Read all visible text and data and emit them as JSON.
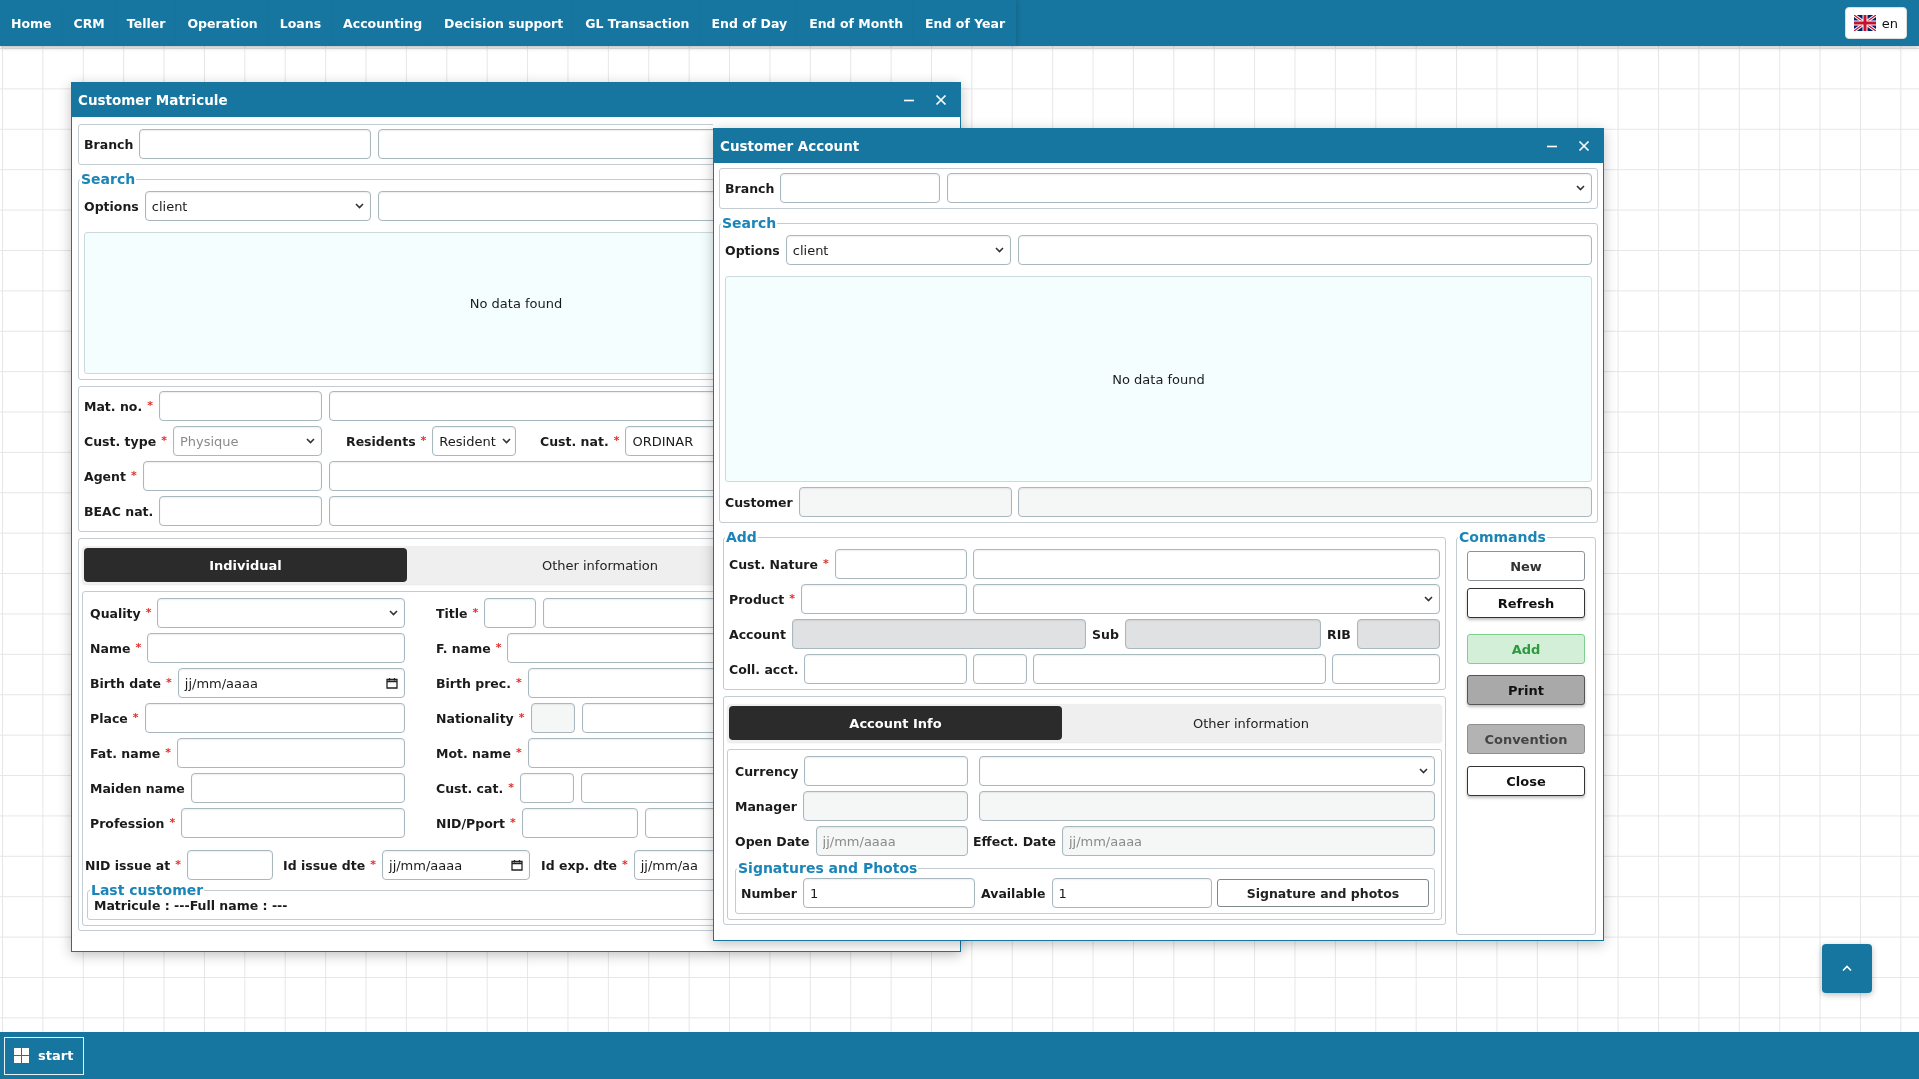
{
  "navbar": {
    "items": [
      {
        "label": "Home"
      },
      {
        "label": "CRM"
      },
      {
        "label": "Teller"
      },
      {
        "label": "Operation"
      },
      {
        "label": "Loans"
      },
      {
        "label": "Accounting"
      },
      {
        "label": "Decision support"
      },
      {
        "label": "GL Transaction"
      },
      {
        "label": "End of Day"
      },
      {
        "label": "End of Month"
      },
      {
        "label": "End of Year"
      }
    ],
    "language": "en"
  },
  "matricule_window": {
    "title": "Customer Matricule",
    "branch_row": [
      {
        "label": "Branch",
        "fields": [
          {
            "kind": "text"
          }
        ]
      },
      {
        "fields": [
          {
            "kind": "text"
          }
        ]
      }
    ],
    "search": {
      "legend": "Search",
      "options_row": [
        {
          "label": "Options",
          "fields": [
            {
              "kind": "select",
              "value": "client"
            }
          ]
        },
        {
          "fields": [
            {
              "kind": "text"
            }
          ]
        }
      ],
      "results": "No data found"
    },
    "identity_rows": [
      [
        {
          "label": "Mat. no.",
          "mark": "*",
          "fields": [
            {
              "kind": "text"
            }
          ]
        },
        {
          "fields": [
            {
              "kind": "text"
            }
          ]
        }
      ],
      [
        {
          "label": "Cust. type",
          "mark": "*",
          "fields": [
            {
              "kind": "select",
              "placeholder": "Physique"
            }
          ]
        },
        {
          "label": "Residents",
          "mark": "*",
          "fields": [
            {
              "kind": "select",
              "value": "Resident"
            }
          ]
        },
        {
          "label": "Cust. nat.",
          "mark": "*",
          "fields": [
            {
              "kind": "text",
              "value": "ORDINAR"
            }
          ]
        }
      ],
      [
        {
          "label": "Agent",
          "mark": "*",
          "fields": [
            {
              "kind": "text"
            }
          ]
        },
        {
          "fields": [
            {
              "kind": "text"
            }
          ]
        }
      ],
      [
        {
          "label": "BEAC nat.",
          "fields": [
            {
              "kind": "text"
            }
          ]
        },
        {
          "fields": [
            {
              "kind": "text"
            }
          ]
        }
      ]
    ],
    "tabs": [
      {
        "label": "Individual",
        "selected": true
      },
      {
        "label": "Other information",
        "selected": false
      }
    ],
    "individual_rows": [
      [
        {
          "label": "Quality",
          "mark": "*",
          "fields": [
            {
              "kind": "select"
            }
          ]
        },
        {
          "label": "Title",
          "mark": "*",
          "fields": [
            {
              "kind": "text"
            },
            {
              "kind": "text"
            }
          ]
        }
      ],
      [
        {
          "label": "Name",
          "mark": "*",
          "fields": [
            {
              "kind": "text"
            }
          ]
        },
        {
          "label": "F. name",
          "mark": "*",
          "fields": [
            {
              "kind": "text"
            }
          ]
        }
      ],
      [
        {
          "label": "Birth date",
          "mark": "*",
          "fields": [
            {
              "kind": "date",
              "value": "jj/mm/aaaa"
            }
          ]
        },
        {
          "label": "Birth prec.",
          "mark": "*",
          "fields": [
            {
              "kind": "text"
            }
          ]
        }
      ],
      [
        {
          "label": "Place",
          "mark": "*",
          "fields": [
            {
              "kind": "text"
            }
          ]
        },
        {
          "label": "Nationality",
          "mark": "*",
          "fields": [
            {
              "kind": "readonly"
            },
            {
              "kind": "text"
            }
          ]
        }
      ],
      [
        {
          "label": "Fat. name",
          "mark": "*",
          "fields": [
            {
              "kind": "text"
            }
          ]
        },
        {
          "label": "Mot. name",
          "mark": "*",
          "fields": [
            {
              "kind": "text"
            }
          ]
        }
      ],
      [
        {
          "label": "Maiden name",
          "fields": [
            {
              "kind": "text"
            }
          ]
        },
        {
          "label": "Cust. cat.",
          "mark": "*",
          "fields": [
            {
              "kind": "text"
            },
            {
              "kind": "text"
            }
          ]
        }
      ],
      [
        {
          "label": "Profession",
          "mark": "*",
          "fields": [
            {
              "kind": "text"
            }
          ]
        },
        {
          "label": "NID/Pport",
          "mark": "*",
          "fields": [
            {
              "kind": "text"
            },
            {
              "kind": "text"
            }
          ]
        }
      ]
    ],
    "dates_row": [
      {
        "label": "NID issue at",
        "mark": "*",
        "fields": [
          {
            "kind": "text"
          }
        ]
      },
      {
        "label": "Id issue dte",
        "mark": "*",
        "fields": [
          {
            "kind": "date",
            "value": "jj/mm/aaaa"
          }
        ]
      },
      {
        "label": "Id exp. dte",
        "mark": "*",
        "fields": [
          {
            "kind": "date",
            "value": "jj/mm/aa"
          }
        ]
      }
    ],
    "last_customer": {
      "legend": "Last customer",
      "text": "Matricule : ---Full name : ---"
    }
  },
  "account_window": {
    "title": "Customer Account",
    "branch_row": [
      {
        "label": "Branch",
        "fields": [
          {
            "kind": "text"
          }
        ]
      },
      {
        "fields": [
          {
            "kind": "select"
          }
        ]
      }
    ],
    "search": {
      "legend": "Search",
      "options_row": [
        {
          "label": "Options",
          "fields": [
            {
              "kind": "select",
              "value": "client"
            }
          ]
        },
        {
          "fields": [
            {
              "kind": "text"
            }
          ]
        }
      ],
      "results": "No data found",
      "customer_row": [
        {
          "label": "Customer",
          "fields": [
            {
              "kind": "readonly"
            }
          ]
        },
        {
          "fields": [
            {
              "kind": "readonly"
            }
          ]
        }
      ]
    },
    "add": {
      "legend": "Add",
      "rows": [
        [
          {
            "label": "Cust. Nature",
            "mark": "*",
            "fields": [
              {
                "kind": "text"
              }
            ]
          },
          {
            "fields": [
              {
                "kind": "text"
              }
            ]
          }
        ],
        [
          {
            "label": "Product",
            "mark": "*",
            "fields": [
              {
                "kind": "text"
              }
            ]
          },
          {
            "fields": [
              {
                "kind": "select"
              }
            ]
          }
        ],
        [
          {
            "label": "Account",
            "fields": [
              {
                "kind": "locked"
              }
            ]
          },
          {
            "label": "Sub",
            "fields": [
              {
                "kind": "locked"
              }
            ]
          },
          {
            "label": "RIB",
            "fields": [
              {
                "kind": "locked"
              }
            ]
          }
        ],
        [
          {
            "label": "Coll. acct.",
            "fields": [
              {
                "kind": "text"
              }
            ]
          },
          {
            "fields": [
              {
                "kind": "text"
              },
              {
                "kind": "text"
              },
              {
                "kind": "text"
              }
            ]
          }
        ]
      ]
    },
    "tabs": [
      {
        "label": "Account Info",
        "selected": true
      },
      {
        "label": "Other information",
        "selected": false
      }
    ],
    "account_info_rows": [
      [
        {
          "label": "Currency",
          "fields": [
            {
              "kind": "text"
            }
          ]
        },
        {
          "fields": [
            {
              "kind": "select"
            }
          ]
        }
      ],
      [
        {
          "label": "Manager",
          "fields": [
            {
              "kind": "readonly"
            }
          ]
        },
        {
          "fields": [
            {
              "kind": "readonly"
            }
          ]
        }
      ],
      [
        {
          "label": "Open Date",
          "fields": [
            {
              "kind": "readonly",
              "placeholder": "jj/mm/aaaa"
            }
          ]
        },
        {
          "label": "Effect. Date",
          "fields": [
            {
              "kind": "readonly",
              "placeholder": "jj/mm/aaaa"
            }
          ]
        }
      ]
    ],
    "signatures": {
      "legend": "Signatures and Photos",
      "row": [
        {
          "label": "Number",
          "fields": [
            {
              "kind": "text",
              "value": "1"
            }
          ]
        },
        {
          "label": "Available",
          "fields": [
            {
              "kind": "text",
              "value": "1"
            }
          ]
        },
        {
          "fields": [
            {
              "kind": "button",
              "label": "Signature and photos"
            }
          ]
        }
      ]
    },
    "commands": {
      "legend": "Commands",
      "buttons": [
        {
          "label": "New",
          "kind": "light"
        },
        {
          "label": "Refresh",
          "kind": "default"
        },
        {
          "label": "Add",
          "kind": "success"
        },
        {
          "label": "Print",
          "kind": "secondary"
        },
        {
          "label": "Convention",
          "kind": "inactive"
        },
        {
          "label": "Close",
          "kind": "default"
        }
      ]
    }
  },
  "taskbar": {
    "start": "start"
  }
}
